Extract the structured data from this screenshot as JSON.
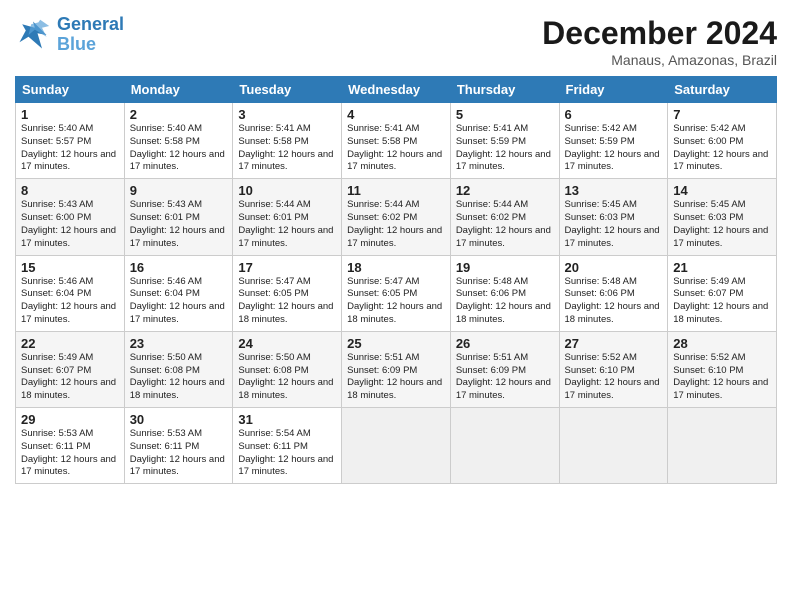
{
  "logo": {
    "line1": "General",
    "line2": "Blue"
  },
  "title": "December 2024",
  "subtitle": "Manaus, Amazonas, Brazil",
  "days_of_week": [
    "Sunday",
    "Monday",
    "Tuesday",
    "Wednesday",
    "Thursday",
    "Friday",
    "Saturday"
  ],
  "weeks": [
    [
      {
        "day": 1,
        "rise": "5:40 AM",
        "set": "5:57 PM",
        "daylight": "12 hours and 17 minutes."
      },
      {
        "day": 2,
        "rise": "5:40 AM",
        "set": "5:58 PM",
        "daylight": "12 hours and 17 minutes."
      },
      {
        "day": 3,
        "rise": "5:41 AM",
        "set": "5:58 PM",
        "daylight": "12 hours and 17 minutes."
      },
      {
        "day": 4,
        "rise": "5:41 AM",
        "set": "5:58 PM",
        "daylight": "12 hours and 17 minutes."
      },
      {
        "day": 5,
        "rise": "5:41 AM",
        "set": "5:59 PM",
        "daylight": "12 hours and 17 minutes."
      },
      {
        "day": 6,
        "rise": "5:42 AM",
        "set": "5:59 PM",
        "daylight": "12 hours and 17 minutes."
      },
      {
        "day": 7,
        "rise": "5:42 AM",
        "set": "6:00 PM",
        "daylight": "12 hours and 17 minutes."
      }
    ],
    [
      {
        "day": 8,
        "rise": "5:43 AM",
        "set": "6:00 PM",
        "daylight": "12 hours and 17 minutes."
      },
      {
        "day": 9,
        "rise": "5:43 AM",
        "set": "6:01 PM",
        "daylight": "12 hours and 17 minutes."
      },
      {
        "day": 10,
        "rise": "5:44 AM",
        "set": "6:01 PM",
        "daylight": "12 hours and 17 minutes."
      },
      {
        "day": 11,
        "rise": "5:44 AM",
        "set": "6:02 PM",
        "daylight": "12 hours and 17 minutes."
      },
      {
        "day": 12,
        "rise": "5:44 AM",
        "set": "6:02 PM",
        "daylight": "12 hours and 17 minutes."
      },
      {
        "day": 13,
        "rise": "5:45 AM",
        "set": "6:03 PM",
        "daylight": "12 hours and 17 minutes."
      },
      {
        "day": 14,
        "rise": "5:45 AM",
        "set": "6:03 PM",
        "daylight": "12 hours and 17 minutes."
      }
    ],
    [
      {
        "day": 15,
        "rise": "5:46 AM",
        "set": "6:04 PM",
        "daylight": "12 hours and 17 minutes."
      },
      {
        "day": 16,
        "rise": "5:46 AM",
        "set": "6:04 PM",
        "daylight": "12 hours and 17 minutes."
      },
      {
        "day": 17,
        "rise": "5:47 AM",
        "set": "6:05 PM",
        "daylight": "12 hours and 18 minutes."
      },
      {
        "day": 18,
        "rise": "5:47 AM",
        "set": "6:05 PM",
        "daylight": "12 hours and 18 minutes."
      },
      {
        "day": 19,
        "rise": "5:48 AM",
        "set": "6:06 PM",
        "daylight": "12 hours and 18 minutes."
      },
      {
        "day": 20,
        "rise": "5:48 AM",
        "set": "6:06 PM",
        "daylight": "12 hours and 18 minutes."
      },
      {
        "day": 21,
        "rise": "5:49 AM",
        "set": "6:07 PM",
        "daylight": "12 hours and 18 minutes."
      }
    ],
    [
      {
        "day": 22,
        "rise": "5:49 AM",
        "set": "6:07 PM",
        "daylight": "12 hours and 18 minutes."
      },
      {
        "day": 23,
        "rise": "5:50 AM",
        "set": "6:08 PM",
        "daylight": "12 hours and 18 minutes."
      },
      {
        "day": 24,
        "rise": "5:50 AM",
        "set": "6:08 PM",
        "daylight": "12 hours and 18 minutes."
      },
      {
        "day": 25,
        "rise": "5:51 AM",
        "set": "6:09 PM",
        "daylight": "12 hours and 18 minutes."
      },
      {
        "day": 26,
        "rise": "5:51 AM",
        "set": "6:09 PM",
        "daylight": "12 hours and 17 minutes."
      },
      {
        "day": 27,
        "rise": "5:52 AM",
        "set": "6:10 PM",
        "daylight": "12 hours and 17 minutes."
      },
      {
        "day": 28,
        "rise": "5:52 AM",
        "set": "6:10 PM",
        "daylight": "12 hours and 17 minutes."
      }
    ],
    [
      {
        "day": 29,
        "rise": "5:53 AM",
        "set": "6:11 PM",
        "daylight": "12 hours and 17 minutes."
      },
      {
        "day": 30,
        "rise": "5:53 AM",
        "set": "6:11 PM",
        "daylight": "12 hours and 17 minutes."
      },
      {
        "day": 31,
        "rise": "5:54 AM",
        "set": "6:11 PM",
        "daylight": "12 hours and 17 minutes."
      },
      null,
      null,
      null,
      null
    ]
  ]
}
